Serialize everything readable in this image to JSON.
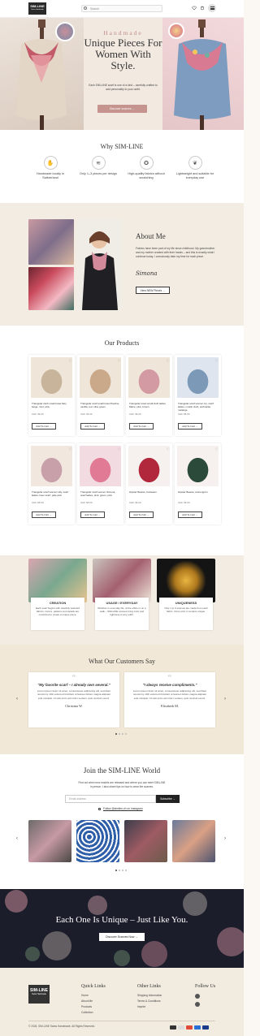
{
  "header": {
    "logo_main": "SIM-LINE",
    "logo_sub": "Swiss Handmade",
    "search_placeholder": "Search"
  },
  "hero": {
    "kicker": "Handmade",
    "title": "Unique Pieces For Women With Style.",
    "text": "Each SIM-LINE scarf is one of a kind – carefully crafted to add personality to your outfit.",
    "button": "Discover scarves →"
  },
  "why": {
    "title": "Why SIM-LINE",
    "items": [
      {
        "label": "Handmade locally in Switzerland",
        "icon": "handshake-icon"
      },
      {
        "label": "Only 1–3 pieces per design",
        "icon": "layers-icon"
      },
      {
        "label": "High-quality fabrics without scratching",
        "icon": "badge-icon"
      },
      {
        "label": "Lightweight and suitable for everyday use",
        "icon": "leaf-icon"
      }
    ]
  },
  "about": {
    "title": "About Me",
    "text": "Fabrics have been part of my life since childhood. My grandmother and my mother created with their hands – and this is exactly what I continue today. I consciously take my time for each piece.",
    "signature": "Simona",
    "button": "View NEW Pieces →"
  },
  "products": {
    "title": "Our Products",
    "add_label": "Add To Cart →",
    "items": [
      {
        "name": "Triangular cloth small towel fairy beige, mint, pink",
        "price": "CHF 39.00"
      },
      {
        "name": "Triangular scarf small towel Pauline, vanilla, red, olive green",
        "price": "CHF 39.00"
      },
      {
        "name": "Triangular towel small cloth ladies Marie, pink, brown",
        "price": "CHF 39.00"
      },
      {
        "name": "Triangular scarf women Ivy, scarf ladies, muslin cloth, anthracite melange",
        "price": "CHF 68.00"
      },
      {
        "name": "Triangular scarf women Lilly, scarf ladies, linen scarf, pale pink",
        "price": "CHF 68.00"
      },
      {
        "name": "Triangular scarf women Simona, scarf ladies, pink, green, pink",
        "price": "CHF 68.00"
      },
      {
        "name": "Hipster Beanie, bordeaux",
        "price": "CHF 39.00"
      },
      {
        "name": "Hipster Beanie, tannengrün",
        "price": "CHF 39.00"
      }
    ]
  },
  "features": [
    {
      "title": "CREATION",
      "text": "Each scarf begins with carefully selected fabrics. Colors, patterns and details are combined to create a unique piece."
    },
    {
      "title": "USAGE / EVERYDAY",
      "text": "Whether in everyday life, at the office or on a walk – SIM-LINE scarves bring color and lightness to any outfit."
    },
    {
      "title": "UNIQUENESS",
      "text": "Only 1 to 3 scarves are made from each fabric. Once sold, it remains unique."
    }
  ],
  "testimonials": {
    "title": "What Our Customers Say",
    "items": [
      {
        "title": "\"My favorite scarf – I already own several.\"",
        "text": "Lorem ipsum dolor sit amet, consectetuer adipiscing elit, sed diam nonummy nibh euismod tincidunt ut laoreet dolore magna aliquam erat volutpat. Ut wisi enim ad minim veniam, quis nostrud exerci.",
        "name": "Christina W."
      },
      {
        "title": "\"I always receive compliments.\"",
        "text": "Lorem ipsum dolor sit amet, consectetuer adipiscing elit, sed diam nonummy nibh euismod tincidunt ut laoreet dolore magna aliquam erat volutpat. Ut wisi enim ad minim veniam, quis nostrud exerci.",
        "name": "Elisabeth M."
      }
    ]
  },
  "newsletter": {
    "title": "Join the SIM-LINE World",
    "text": "Find out when new models are released and where you can meet SIM-LINE in person. I also share tips on how to wear the scarves.",
    "placeholder": "Email address",
    "button": "Subscribe →",
    "insta": "Follow @simline.ch on Instagram"
  },
  "banner": {
    "title": "Each One Is Unique – Just Like You.",
    "button": "Discover Scarves Now →"
  },
  "footer": {
    "quick_title": "Quick Links",
    "quick_links": [
      "Home",
      "About Me",
      "Products",
      "Collection"
    ],
    "other_title": "Other Links",
    "other_links": [
      "Shipping Information",
      "Terms & Conditions",
      "Imprint"
    ],
    "follow_title": "Follow Us",
    "copyright": "© 2026, SIM-LINE Swiss Handmade. All Rights Reserved."
  },
  "colors": {
    "accent": "#c6948f",
    "dark": "#222222",
    "beige": "#f3ece2"
  }
}
